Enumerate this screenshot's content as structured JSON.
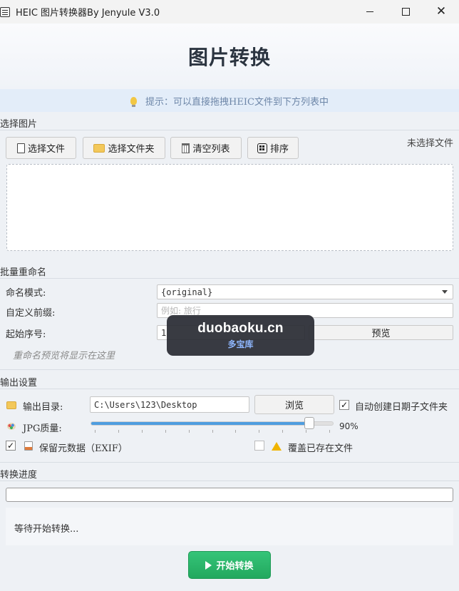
{
  "window": {
    "title": "HEIC 图片转换器By Jenyule V3.0",
    "minimize_icon": "minimize-icon",
    "maximize_icon": "maximize-icon",
    "close_glyph": "✕"
  },
  "header": {
    "title": "图片转换"
  },
  "tip": {
    "text": "提示：可以直接拖拽HEIC文件到下方列表中"
  },
  "select_section": {
    "label": "选择图片",
    "buttons": {
      "select_file": "选择文件",
      "select_folder": "选择文件夹",
      "clear_list": "清空列表",
      "sort": "排序"
    },
    "no_file_text": "未选择文件"
  },
  "rename_section": {
    "label": "批量重命名",
    "naming_mode_label": "命名模式:",
    "naming_mode_value": "{original}",
    "prefix_label": "自定义前缀:",
    "prefix_placeholder": "例如: 旅行",
    "start_num_label": "起始序号:",
    "start_num_value": "1",
    "preview_button": "预览",
    "preview_placeholder": "重命名预览将显示在这里"
  },
  "output_section": {
    "label": "输出设置",
    "dir_label": "输出目录:",
    "dir_value": "C:\\Users\\123\\Desktop",
    "browse_button": "浏览",
    "auto_date_label": "自动创建日期子文件夹",
    "auto_date_checked": true,
    "quality_label": "JPG质量:",
    "quality_value_text": "90%",
    "quality_value": 90,
    "keep_exif_label": "保留元数据（EXIF）",
    "keep_exif_checked": true,
    "overwrite_label": "覆盖已存在文件",
    "overwrite_checked": false
  },
  "progress_section": {
    "label": "转换进度",
    "progress_value": 0,
    "status_text": "等待开始转换..."
  },
  "start_button": "开始转换",
  "watermark": {
    "domain": "duobaoku.cn",
    "name": "多宝库"
  },
  "colors": {
    "accent": "#4e9de0",
    "start": "#2bb56a",
    "tip_bg": "#e3edf9"
  }
}
